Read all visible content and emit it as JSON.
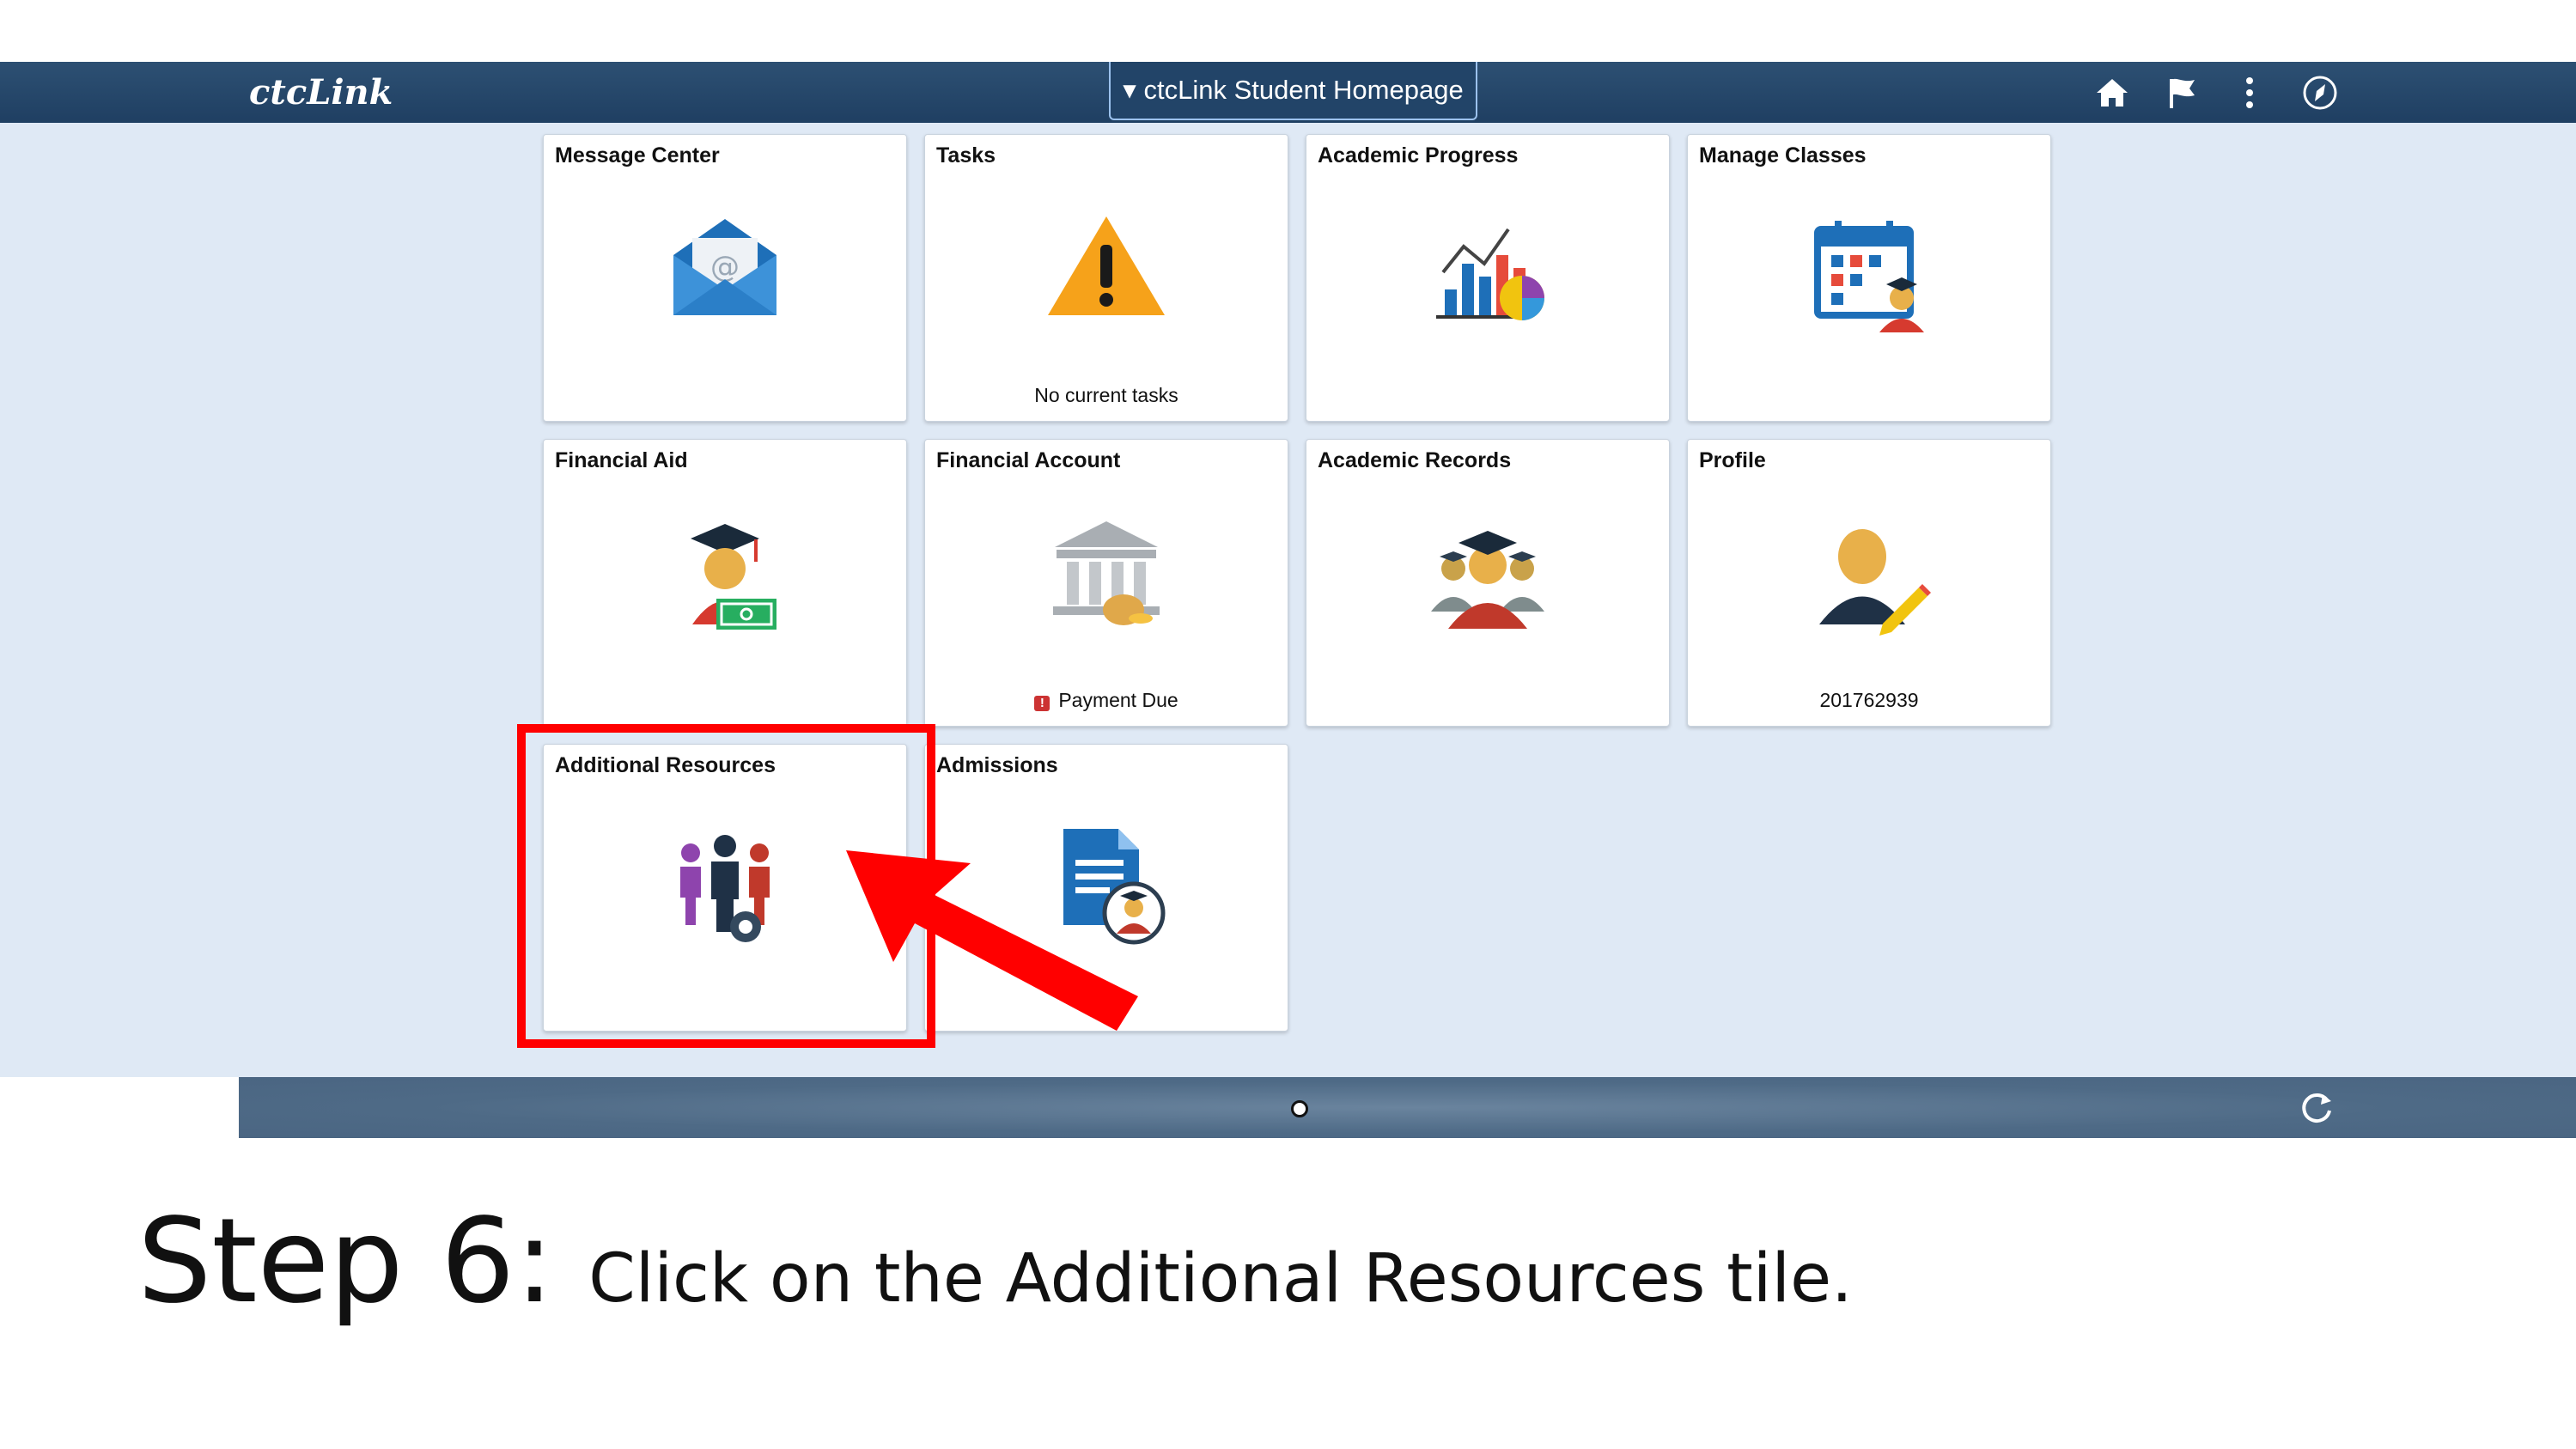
{
  "header": {
    "logo": "ctcLink",
    "homepage_select": "ctcLink Student Homepage",
    "icons": [
      "home-icon",
      "flag-icon",
      "more-vertical-icon",
      "navbar-compass-icon"
    ]
  },
  "tiles": [
    {
      "title": "Message Center",
      "status": "",
      "icon": "mail-icon"
    },
    {
      "title": "Tasks",
      "status": "No current tasks",
      "icon": "warning-icon"
    },
    {
      "title": "Academic Progress",
      "status": "",
      "icon": "chart-icon"
    },
    {
      "title": "Manage Classes",
      "status": "",
      "icon": "calendar-student-icon"
    },
    {
      "title": "Financial Aid",
      "status": "",
      "icon": "graduate-money-icon"
    },
    {
      "title": "Financial Account",
      "status": "Payment Due",
      "icon": "bank-icon"
    },
    {
      "title": "Academic Records",
      "status": "",
      "icon": "graduates-group-icon"
    },
    {
      "title": "Profile",
      "status": "201762939",
      "icon": "profile-edit-icon"
    },
    {
      "title": "Additional Resources",
      "status": "",
      "icon": "people-gear-icon"
    },
    {
      "title": "Admissions",
      "status": "",
      "icon": "document-student-icon"
    }
  ],
  "footer": {
    "page_indicator": "page-dot",
    "refresh_icon": "refresh-icon"
  },
  "caption": {
    "step": "Step 6:",
    "text_before": "Click on the ",
    "text_bold": "Additional Resources",
    "text_after": " tile."
  },
  "colors": {
    "header": "#224468",
    "stage": "#dfe9f5",
    "highlight": "#ff0000",
    "footer": "#4e6a86"
  }
}
